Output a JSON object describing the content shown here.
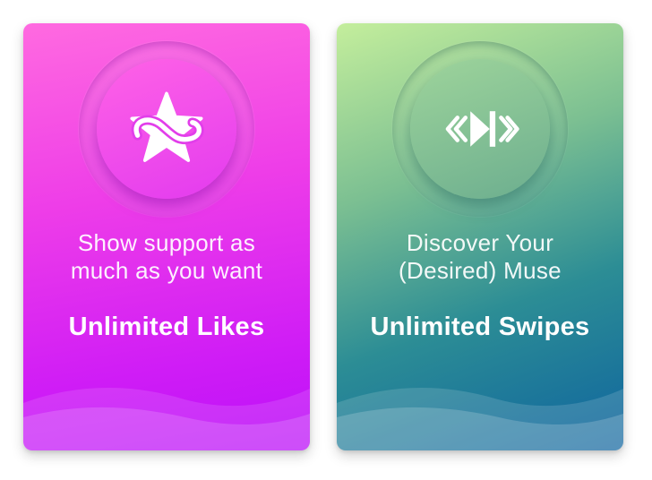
{
  "cards": [
    {
      "tagline": "Show support as\nmuch as you want",
      "title": "Unlimited Likes",
      "icon": "infinity-star-icon",
      "colors": {
        "top": "#ff6ae0",
        "bottom": "#bb10f8"
      }
    },
    {
      "tagline": "Discover Your\n(Desired) Muse",
      "title": "Unlimited Swipes",
      "icon": "skip-forward-icon",
      "colors": {
        "top": "#c4ee9c",
        "bottom": "#0f649f"
      }
    }
  ]
}
